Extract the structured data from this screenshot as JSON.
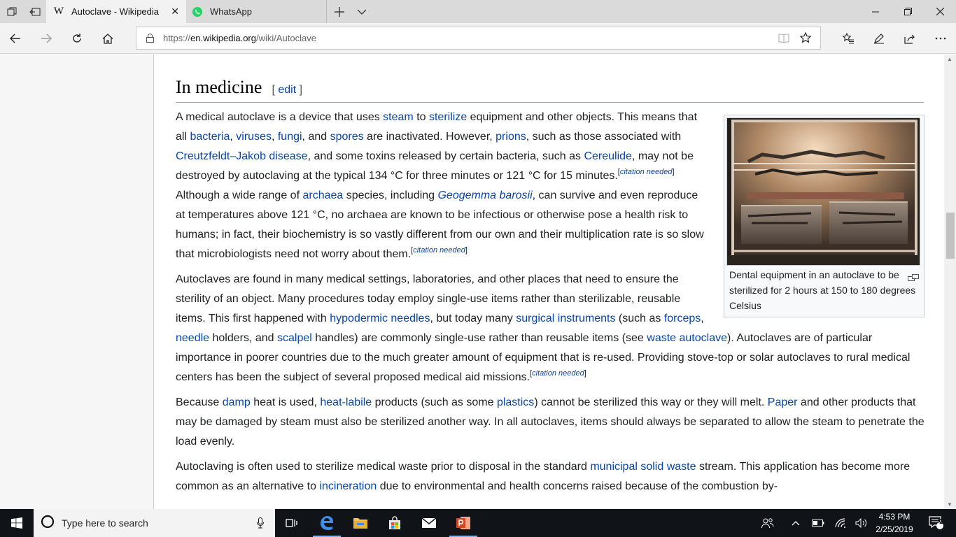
{
  "browser": {
    "tabs": [
      {
        "title": "Autoclave - Wikipedia",
        "favicon": "W",
        "active": true
      },
      {
        "title": "WhatsApp",
        "favicon": "whatsapp-icon",
        "active": false
      }
    ],
    "url": {
      "scheme": "https://",
      "host": "en.wikipedia.org",
      "path": "/wiki/Autoclave"
    }
  },
  "article": {
    "heading": "In medicine",
    "edit_open": "[ ",
    "edit_label": "edit",
    "edit_close": " ]",
    "figure": {
      "caption": "Dental equipment in an autoclave to be sterilized for 2 hours at 150 to 180 degrees Celsius"
    },
    "citation_needed": "citation needed",
    "p1": {
      "t1": "A medical autoclave is a device that uses ",
      "l1": "steam",
      "t2": " to ",
      "l2": "sterilize",
      "t3": " equipment and other objects. This means that all ",
      "l3": "bacteria",
      "t4": ", ",
      "l4": "viruses",
      "t5": ", ",
      "l5": "fungi",
      "t6": ", and ",
      "l6": "spores",
      "t7": " are inactivated. However, ",
      "l7": "prions",
      "t8": ", such as those associated with ",
      "l8": "Creutzfeldt–Jakob disease",
      "t9": ", and some toxins released by certain bacteria, such as ",
      "l9": "Cereulide",
      "t10": ", may not be destroyed by autoclaving at the typical 134 °C for three minutes or 121 °C for 15 minutes.",
      "t11": " Although a wide range of ",
      "l10": "archaea",
      "t12": " species, including ",
      "l11": "Geogemma barosii",
      "t13": ", can survive and even reproduce at temperatures above 121 °C, no archaea are known to be infectious or otherwise pose a health risk to humans; in fact, their biochemistry is so vastly different from our own and their multiplication rate is so slow that microbiologists need not worry about them."
    },
    "p2": {
      "t1": "Autoclaves are found in many medical settings, laboratories, and other places that need to ensure the sterility of an object. Many procedures today employ single-use items rather than sterilizable, reusable items. This first happened with ",
      "l1": "hypodermic needles",
      "t2": ", but today many ",
      "l2": "surgical instruments",
      "t3": " (such as ",
      "l3": "forceps",
      "t4": ", ",
      "l4": "needle",
      "t5": " holders, and ",
      "l5": "scalpel",
      "t6": " handles) are commonly single-use rather than reusable items (see ",
      "l6": "waste autoclave",
      "t7": "). Autoclaves are of particular importance in poorer countries due to the much greater amount of equipment that is re-used. Providing stove-top or solar autoclaves to rural medical centers has been the subject of several proposed medical aid missions."
    },
    "p3": {
      "t1": "Because ",
      "l1": "damp",
      "t2": " heat is used, ",
      "l2": "heat-labile",
      "t3": " products (such as some ",
      "l3": "plastics",
      "t4": ") cannot be sterilized this way or they will melt. ",
      "l4": "Paper",
      "t5": " and other products that may be damaged by steam must also be sterilized another way. In all autoclaves, items should always be separated to allow the steam to penetrate the load evenly."
    },
    "p4": {
      "t1": "Autoclaving is often used to sterilize medical waste prior to disposal in the standard ",
      "l1": "municipal solid waste",
      "t2": " stream. This application has become more common as an alternative to ",
      "l2": "incineration",
      "t3": " due to environmental and health concerns raised because of the combustion by-"
    }
  },
  "taskbar": {
    "search_placeholder": "Type here to search",
    "time": "4:53 PM",
    "date": "2/25/2019",
    "notification_count": "2"
  },
  "colors": {
    "link": "#0645ad",
    "text": "#202122",
    "taskbar": "#101418",
    "tab_active": "#f2f2f2"
  }
}
